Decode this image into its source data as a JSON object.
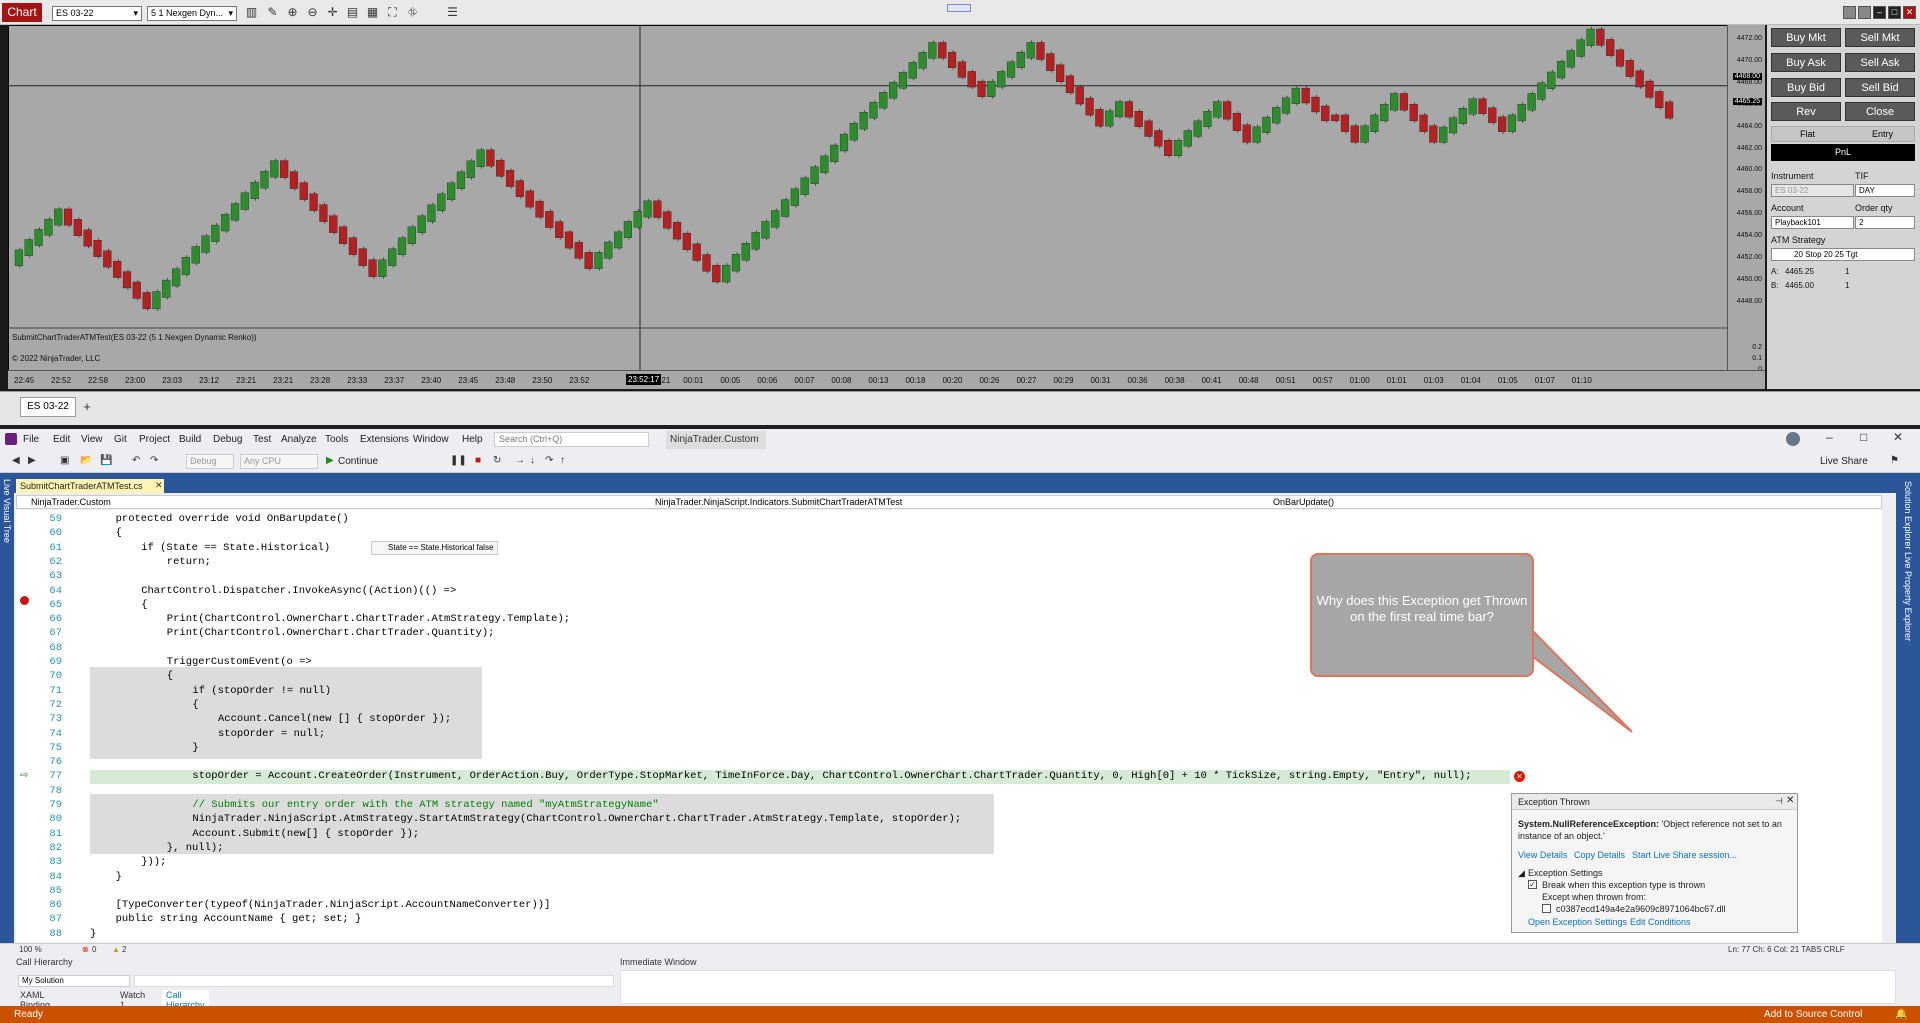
{
  "nt": {
    "chart_label": "Chart",
    "instrument_select": "ES 03-22",
    "bar_type_select": "5 1 Nexgen Dyn...",
    "indicator_label": "SubmitChartTraderATMTest(ES 03-22 (5 1 Nexgen Dynamic Renko))",
    "copyright": "© 2022 NinjaTrader, LLC",
    "tab": "ES 03-22",
    "add_tab": "+",
    "crosshair_time": "23:52:17",
    "price_labels": [
      "4472.00",
      "4470.00",
      "4468.00",
      "4466.00",
      "4464.00",
      "4462.00",
      "4460.00",
      "4458.00",
      "4456.00",
      "4454.00",
      "4452.00",
      "4450.00",
      "4448.00"
    ],
    "price_current": "4465.25",
    "price_cross": "4468.00",
    "indicator_axis": [
      "0.2",
      "0.1",
      "0"
    ],
    "time_labels": [
      "22:45",
      "22:52",
      "22:58",
      "23:00",
      "23:03",
      "23:12",
      "23:21",
      "23:21",
      "23:28",
      "23:33",
      "23:37",
      "23:40",
      "23:45",
      "23:48",
      "23:50",
      "23:52",
      "Jan 21",
      "00:01",
      "00:05",
      "00:06",
      "00:07",
      "00:08",
      "00:13",
      "00:18",
      "00:20",
      "00:26",
      "00:27",
      "00:29",
      "00:31",
      "00:36",
      "00:38",
      "00:41",
      "00:48",
      "00:51",
      "00:57",
      "01:00",
      "01:01",
      "01:03",
      "01:04",
      "01:05",
      "01:07",
      "01:10"
    ]
  },
  "trader": {
    "buy_mkt": "Buy Mkt",
    "sell_mkt": "Sell Mkt",
    "buy_ask": "Buy Ask",
    "sell_ask": "Sell Ask",
    "buy_bid": "Buy Bid",
    "sell_bid": "Sell Bid",
    "rev": "Rev",
    "close": "Close",
    "flat": "Flat",
    "entry": "Entry",
    "pnl": "PnL",
    "instrument_label": "Instrument",
    "tif_label": "TIF",
    "instrument_value": "ES 03-22",
    "tif_value": "DAY",
    "account_label": "Account",
    "qty_label": "Order qty",
    "account_value": "Playback101",
    "qty_value": "2",
    "atm_label": "ATM Strategy",
    "atm_value": "20 Stop 20  25 Tgt",
    "a_label": "A:",
    "a_price": "4465.25",
    "a_qty": "1",
    "b_label": "B:",
    "b_price": "4465.00",
    "b_qty": "1"
  },
  "vs": {
    "menu": [
      "File",
      "Edit",
      "View",
      "Git",
      "Project",
      "Build",
      "Debug",
      "Test",
      "Analyze",
      "Tools",
      "Extensions",
      "Window",
      "Help"
    ],
    "search_placeholder": "Search (Ctrl+Q)",
    "project": "NinjaTrader.Custom",
    "config": "Debug",
    "platform": "Any CPU",
    "continue": "Continue",
    "live_share": "Live Share",
    "doc_tab": "SubmitChartTraderATMTest.cs",
    "nav_left": "NinjaTrader.Custom",
    "nav_mid": "NinjaTrader.NinjaScript.Indicators.SubmitChartTraderATMTest",
    "nav_right": "OnBarUpdate()",
    "left_vertical": "Live Visual Tree",
    "right_vertical": "Solution Explorer   Live Property Explorer",
    "datatip": "State == State.Historical  false",
    "zoom": "100 %",
    "errors": "0",
    "warnings": "2",
    "position": "Ln: 77    Ch: 6    Col: 21    TABS    CRLF",
    "call_hierarchy": "Call Hierarchy",
    "my_solution": "My Solution",
    "immediate": "Immediate Window",
    "bottom_tabs": [
      "XAML Binding Failures",
      "Watch 1",
      "Call Hierarchy"
    ],
    "status": "Ready",
    "source_control": "Add to Source Control"
  },
  "code": {
    "line_numbers": [
      "59",
      "60",
      "61",
      "62",
      "63",
      "64",
      "65",
      "66",
      "67",
      "68",
      "69",
      "70",
      "71",
      "72",
      "73",
      "74",
      "75",
      "76",
      "77",
      "78",
      "79",
      "80",
      "81",
      "82",
      "83",
      "84",
      "85",
      "86",
      "87",
      "88"
    ],
    "l59": "protected override void OnBarUpdate()",
    "l60": "{",
    "l61": "if (State == State.Historical)",
    "l62": "return;",
    "l64": "ChartControl.Dispatcher.InvokeAsync((Action)(() =>",
    "l65": "{",
    "l66": "Print(ChartControl.OwnerChart.ChartTrader.AtmStrategy.Template);",
    "l67": "Print(ChartControl.OwnerChart.ChartTrader.Quantity);",
    "l69": "TriggerCustomEvent(o =>",
    "l70": "{",
    "l71": "if (stopOrder != null)",
    "l72": "{",
    "l73": "Account.Cancel(new [] { stopOrder });",
    "l74": "stopOrder = null;",
    "l75": "}",
    "l77": "stopOrder = Account.CreateOrder(Instrument, OrderAction.Buy, OrderType.StopMarket, TimeInForce.Day, ChartControl.OwnerChart.ChartTrader.Quantity, 0, High[0] + 10 * TickSize, string.Empty, \"Entry\", null);",
    "l79": "// Submits our entry order with the ATM strategy named \"myAtmStrategyName\"",
    "l80": "NinjaTrader.NinjaScript.AtmStrategy.StartAtmStrategy(ChartControl.OwnerChart.ChartTrader.AtmStrategy.Template, stopOrder);",
    "l81": "Account.Submit(new[] { stopOrder });",
    "l82": "}, null);",
    "l83": "}));",
    "l84": "}",
    "l86": "[TypeConverter(typeof(NinjaTrader.NinjaScript.AccountNameConverter))]",
    "l87": "public string AccountName { get; set; }",
    "l88": "}"
  },
  "callout": "Why does this Exception get Thrown on the first real time bar?",
  "exception": {
    "title": "Exception Thrown",
    "type": "System.NullReferenceException:",
    "message": " 'Object reference not set to an instance of an object.'",
    "view_details": "View Details",
    "copy_details": "Copy Details",
    "live_share": "Start Live Share session...",
    "settings": "Exception Settings",
    "break_when": "Break when this exception type is thrown",
    "except_when": "Except when thrown from:",
    "dll": "c0387ecd149a4e2a9609c8971064bc67.dll",
    "open_settings": "Open Exception Settings",
    "edit_conditions": "Edit Conditions"
  },
  "chart_data": {
    "type": "renko",
    "instrument": "ES 03-22",
    "ylim": [
      4446,
      4473
    ],
    "path_prices": [
      4451.5,
      4456.25,
      4447.5,
      4451.75,
      4460.75,
      4450.5,
      4461.75,
      4451.25,
      4457.0,
      4450.0,
      4465.25,
      4471.75,
      4467.25,
      4471.75,
      4464.5,
      4466.25,
      4461.75,
      4466.25,
      4463.0,
      4467.5,
      4465.0,
      4465.0,
      4463.0,
      4467.0,
      4463.0,
      4466.5,
      4464.0,
      4473.0,
      4465.25
    ]
  }
}
